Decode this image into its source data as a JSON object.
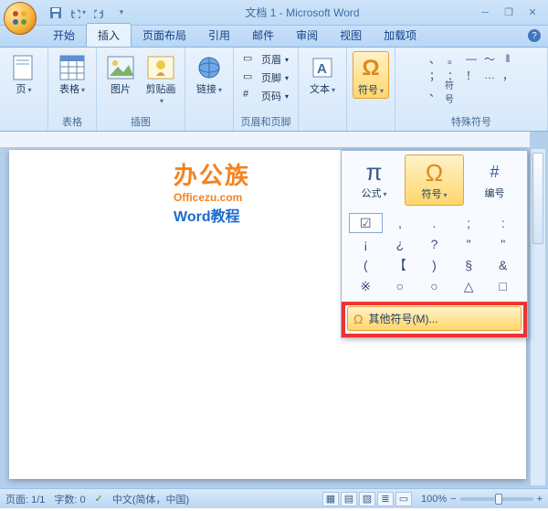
{
  "title": "文档 1 - Microsoft Word",
  "qat": {
    "save": "保存",
    "undo": "撤销",
    "redo": "重做"
  },
  "tabs": [
    "开始",
    "插入",
    "页面布局",
    "引用",
    "邮件",
    "审阅",
    "视图",
    "加载项"
  ],
  "active_tab": 1,
  "ribbon": {
    "page_btn": "页",
    "table_btn": "表格",
    "tables_group": "表格",
    "picture_btn": "图片",
    "clipart_btn": "剪贴画",
    "illustrations_group": "插图",
    "link_btn": "链接",
    "header_btn": "页眉",
    "footer_btn": "页脚",
    "pagenum_btn": "页码",
    "headerfooter_group": "页眉和页脚",
    "textbox_btn": "文本",
    "symbol_btn": "符号",
    "specialchars_group": "特殊符号",
    "special_symbols": [
      "、",
      "。",
      "—",
      "～",
      "‖",
      "；",
      "：",
      "！",
      "…",
      "，",
      "、",
      "符号"
    ]
  },
  "dropdown": {
    "equation": "公式",
    "symbol": "符号",
    "number": "编号",
    "grid": [
      "☑",
      ",",
      ".",
      ";",
      ":",
      "¡",
      "¿",
      "?",
      "\"",
      "\"",
      "(",
      "【",
      ")",
      "§",
      "&",
      "※",
      "○",
      "○",
      "△",
      "□"
    ],
    "more": "其他符号(M)..."
  },
  "watermark": {
    "line1a": "办公",
    "line1b": "族",
    "line2": "Officezu.com",
    "line3": "Word教程"
  },
  "status": {
    "page": "页面: 1/1",
    "words": "字数: 0",
    "lang": "中文(简体，中国)",
    "zoom": "100%"
  }
}
